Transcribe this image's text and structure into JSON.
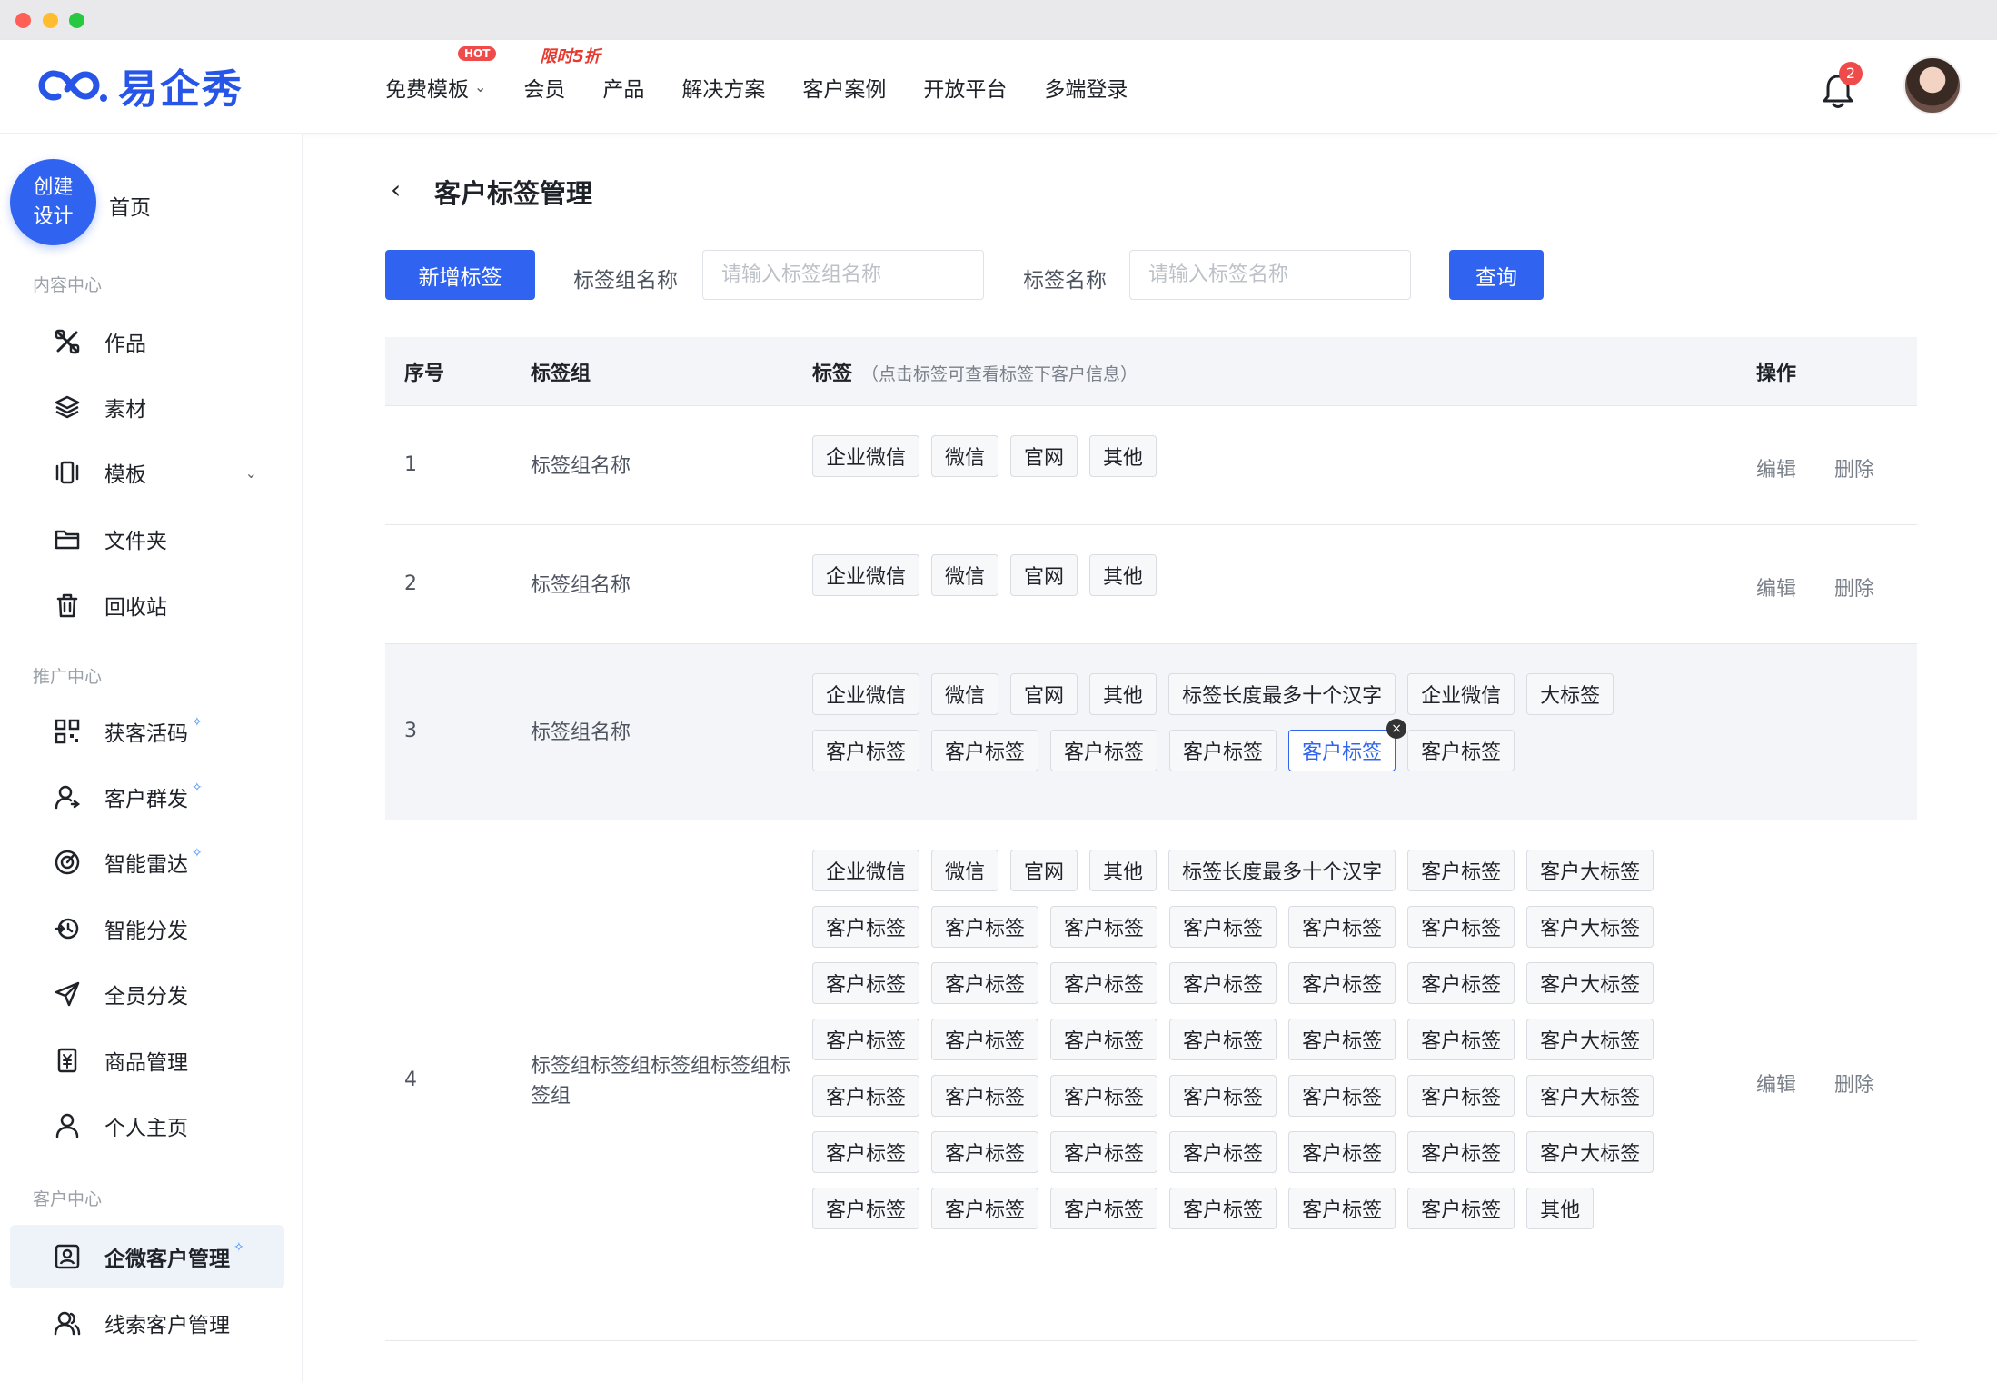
{
  "header": {
    "logo_text": "易企秀",
    "nav": [
      {
        "label": "免费模板",
        "badge": "HOT",
        "has_dropdown": true
      },
      {
        "label": "会员",
        "badge": "限时5折"
      },
      {
        "label": "产品"
      },
      {
        "label": "解决方案"
      },
      {
        "label": "客户案例"
      },
      {
        "label": "开放平台"
      },
      {
        "label": "多端登录"
      }
    ],
    "notification_count": "2"
  },
  "sidebar": {
    "create_button": "创建\n设计",
    "home": "首页",
    "sections": [
      {
        "title": "内容中心",
        "items": [
          {
            "label": "作品",
            "icon": "tools-icon"
          },
          {
            "label": "素材",
            "icon": "layers-icon"
          },
          {
            "label": "模板",
            "icon": "template-icon",
            "has_dropdown": true
          },
          {
            "label": "文件夹",
            "icon": "folder-icon"
          },
          {
            "label": "回收站",
            "icon": "trash-icon"
          }
        ]
      },
      {
        "title": "推广中心",
        "items": [
          {
            "label": "获客活码",
            "icon": "qrcode-icon",
            "new": true
          },
          {
            "label": "客户群发",
            "icon": "user-broadcast-icon",
            "new": true
          },
          {
            "label": "智能雷达",
            "icon": "radar-icon",
            "new": true
          },
          {
            "label": "智能分发",
            "icon": "distribute-icon"
          },
          {
            "label": "全员分发",
            "icon": "send-icon"
          },
          {
            "label": "商品管理",
            "icon": "product-icon"
          },
          {
            "label": "个人主页",
            "icon": "person-icon"
          }
        ]
      },
      {
        "title": "客户中心",
        "items": [
          {
            "label": "企微客户管理",
            "icon": "contact-card-icon",
            "new": true,
            "active": true
          },
          {
            "label": "线索客户管理",
            "icon": "users-icon"
          }
        ]
      }
    ]
  },
  "main": {
    "title": "客户标签管理",
    "add_button": "新增标签",
    "filters": {
      "group_label": "标签组名称",
      "group_placeholder": "请输入标签组名称",
      "name_label": "标签名称",
      "name_placeholder": "请输入标签名称",
      "query_button": "查询"
    },
    "table": {
      "columns": {
        "index": "序号",
        "group": "标签组",
        "tags": "标签",
        "tags_hint": "（点击标签可查看标签下客户信息）",
        "ops": "操作"
      },
      "edit_label": "编辑",
      "delete_label": "删除",
      "rows": [
        {
          "index": "1",
          "group": "标签组名称",
          "tags": [
            "企业微信",
            "微信",
            "官网",
            "其他"
          ]
        },
        {
          "index": "2",
          "group": "标签组名称",
          "tags": [
            "企业微信",
            "微信",
            "官网",
            "其他"
          ]
        },
        {
          "index": "3",
          "group": "标签组名称",
          "selected_tag": 11,
          "tags": [
            "企业微信",
            "微信",
            "官网",
            "其他",
            "标签长度最多十个汉字",
            "企业微信",
            "大标签",
            "客户标签",
            "客户标签",
            "客户标签",
            "客户标签",
            "客户标签",
            "客户标签"
          ]
        },
        {
          "index": "4",
          "group": "标签组标签组标签组标签组标签组",
          "tags": [
            "企业微信",
            "微信",
            "官网",
            "其他",
            "标签长度最多十个汉字",
            "客户标签",
            "客户大标签",
            "客户标签",
            "客户标签",
            "客户标签",
            "客户标签",
            "客户标签",
            "客户标签",
            "客户大标签",
            "客户标签",
            "客户标签",
            "客户标签",
            "客户标签",
            "客户标签",
            "客户标签",
            "客户大标签",
            "客户标签",
            "客户标签",
            "客户标签",
            "客户标签",
            "客户标签",
            "客户标签",
            "客户大标签",
            "客户标签",
            "客户标签",
            "客户标签",
            "客户标签",
            "客户标签",
            "客户标签",
            "客户大标签",
            "客户标签",
            "客户标签",
            "客户标签",
            "客户标签",
            "客户标签",
            "客户标签",
            "客户大标签",
            "客户标签",
            "客户标签",
            "客户标签",
            "客户标签",
            "客户标签",
            "客户标签",
            "其他"
          ]
        }
      ]
    }
  },
  "colors": {
    "primary": "#2f63f0",
    "hot": "#ef4b4b",
    "muted": "#7a808a"
  }
}
